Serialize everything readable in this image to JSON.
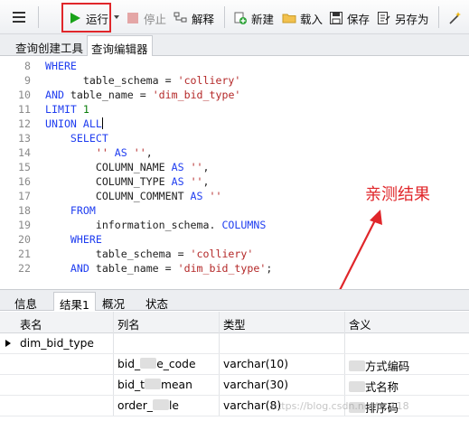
{
  "toolbar": {
    "run": "运行",
    "stop": "停止",
    "explain": "解释",
    "new": "新建",
    "load": "载入",
    "save": "保存",
    "save_as": "另存为"
  },
  "editor_tabs": [
    "查询创建工具",
    "查询编辑器"
  ],
  "code_lines": [
    {
      "n": "8",
      "html": "<span class=\"kw\">WHERE</span>"
    },
    {
      "n": "9",
      "html": "      table_schema = <span class=\"str\">'colliery'</span>"
    },
    {
      "n": "10",
      "html": "<span class=\"kw\">AND</span> table_name = <span class=\"str\">'dim_bid_type'</span>"
    },
    {
      "n": "11",
      "html": "<span class=\"kw\">LIMIT</span> <span class=\"num\">1</span>"
    },
    {
      "n": "12",
      "html": "<span class=\"kw\">UNION ALL</span><span class=\"cursor\"></span>"
    },
    {
      "n": "13",
      "html": "    <span class=\"kw\">SELECT</span>"
    },
    {
      "n": "14",
      "html": "        <span class=\"str\">''</span> <span class=\"kw\">AS</span> <span class=\"str\">''</span>,"
    },
    {
      "n": "15",
      "html": "        COLUMN_NAME <span class=\"kw\">AS</span> <span class=\"str\">''</span>,"
    },
    {
      "n": "16",
      "html": "        COLUMN_TYPE <span class=\"kw\">AS</span> <span class=\"str\">''</span>,"
    },
    {
      "n": "17",
      "html": "        COLUMN_COMMENT <span class=\"kw\">AS</span> <span class=\"str\">''</span>"
    },
    {
      "n": "18",
      "html": "    <span class=\"kw\">FROM</span>"
    },
    {
      "n": "19",
      "html": "        information_schema. <span class=\"kw\">COLUMNS</span>"
    },
    {
      "n": "20",
      "html": "    <span class=\"kw\">WHERE</span>"
    },
    {
      "n": "21",
      "html": "        table_schema = <span class=\"str\">'colliery'</span>"
    },
    {
      "n": "22",
      "html": "    <span class=\"kw\">AND</span> table_name = <span class=\"str\">'dim_bid_type'</span>;"
    }
  ],
  "annotation": "亲测结果",
  "result_tabs": [
    "信息",
    "结果1",
    "概况",
    "状态"
  ],
  "grid": {
    "columns": [
      "表名",
      "列名",
      "类型",
      "含义"
    ],
    "rows": [
      {
        "table": "dim_bid_type",
        "col": "",
        "type": "",
        "meaning": ""
      },
      {
        "table": "",
        "col_a": "bid_",
        "col_b": "e_code",
        "type": "varchar(10)",
        "meaning_b": "方式编码"
      },
      {
        "table": "",
        "col_a": "bid_t",
        "col_b": "mean",
        "type": "varchar(30)",
        "meaning_b": "式名称"
      },
      {
        "table": "",
        "col_a": "order_",
        "col_b": "le",
        "type": "varchar(8)",
        "meaning_b": "排序码"
      }
    ]
  },
  "watermark": "https://blog.csdn.net/... 118",
  "colors": {
    "highlight": "#e0262a",
    "keyword": "#1f3df0",
    "string": "#b42828",
    "number": "#0a7d0a"
  }
}
